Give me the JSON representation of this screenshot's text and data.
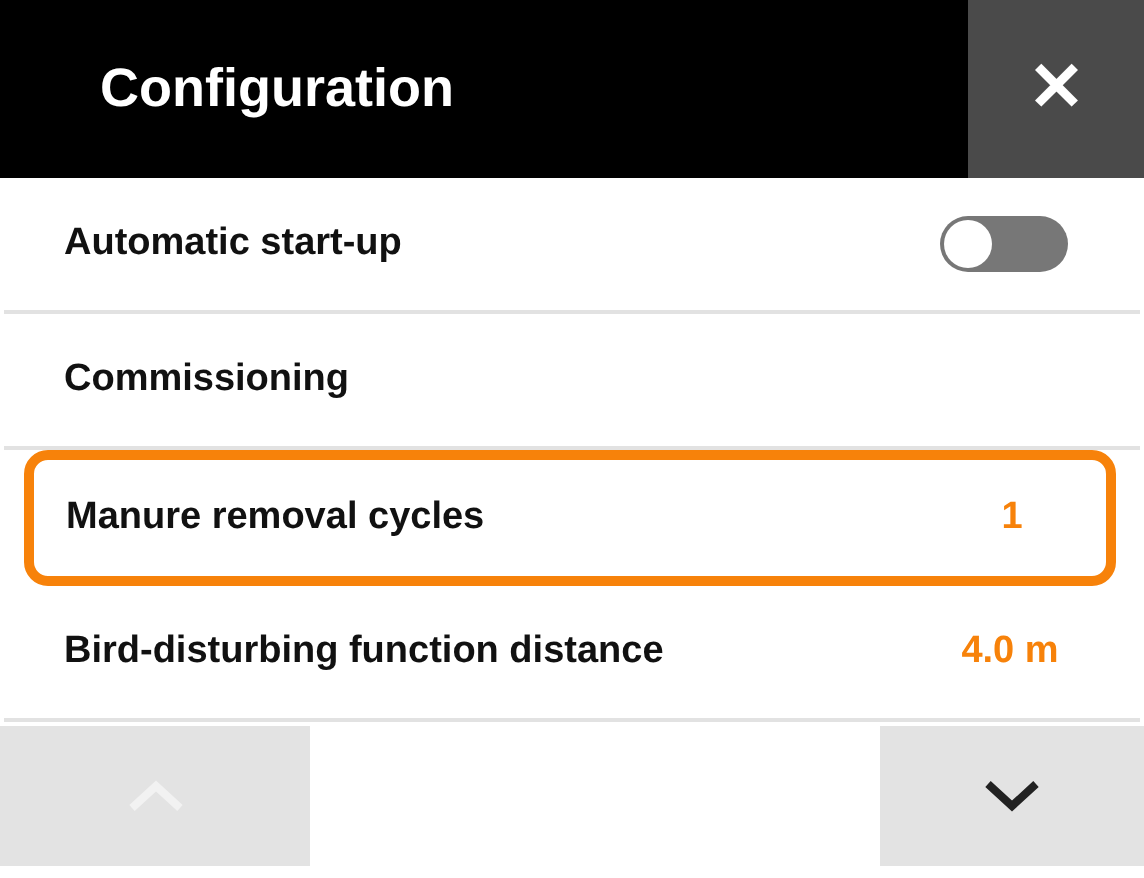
{
  "header": {
    "title": "Configuration",
    "close": "✕"
  },
  "items": [
    {
      "kind": "toggle",
      "label": "Automatic start-up",
      "on": false,
      "selected": false
    },
    {
      "kind": "plain",
      "label": "Commissioning",
      "selected": false
    },
    {
      "kind": "value",
      "label": "Manure removal cycles",
      "value": "1",
      "selected": true
    },
    {
      "kind": "value",
      "label": "Bird-disturbing function distance",
      "value": "4.0 m",
      "selected": false
    }
  ],
  "nav": {
    "up_disabled": true,
    "down_disabled": false
  }
}
